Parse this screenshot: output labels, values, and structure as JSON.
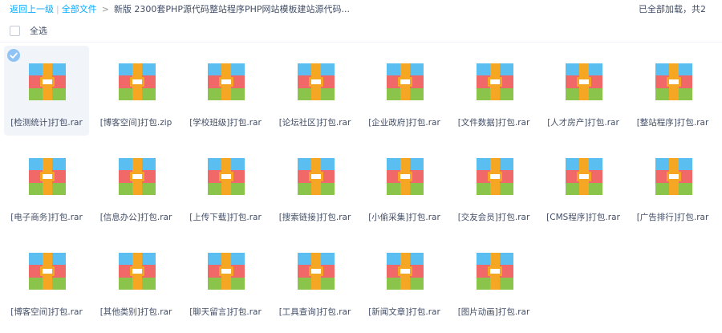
{
  "breadcrumb": {
    "back": "返回上一级",
    "all_files": "全部文件",
    "current": "新版 2300套PHP源代码整站程序PHP网站模板建站源代码..."
  },
  "status": "已全部加载，共2",
  "select_all_label": "全选",
  "colors": {
    "accent": "#09aaff",
    "selected_bg": "#f1f5fa",
    "check_badge": "#8fc3f5",
    "archive_top": "#5bbef0",
    "archive_middle": "#f06868",
    "archive_bottom": "#8ac44a",
    "archive_belt": "#f5a623"
  },
  "files": [
    {
      "name": "[检测统计]打包.rar",
      "selected": true,
      "icon": "archive-icon"
    },
    {
      "name": "[博客空间]打包.zip",
      "selected": false,
      "icon": "archive-icon"
    },
    {
      "name": "[学校班级]打包.rar",
      "selected": false,
      "icon": "archive-icon"
    },
    {
      "name": "[论坛社区]打包.rar",
      "selected": false,
      "icon": "archive-icon"
    },
    {
      "name": "[企业政府]打包.rar",
      "selected": false,
      "icon": "archive-icon"
    },
    {
      "name": "[文件数据]打包.rar",
      "selected": false,
      "icon": "archive-icon"
    },
    {
      "name": "[人才房产]打包.rar",
      "selected": false,
      "icon": "archive-icon"
    },
    {
      "name": "[整站程序]打包.rar",
      "selected": false,
      "icon": "archive-icon"
    },
    {
      "name": "[电子商务]打包.rar",
      "selected": false,
      "icon": "archive-icon"
    },
    {
      "name": "[信息办公]打包.rar",
      "selected": false,
      "icon": "archive-icon"
    },
    {
      "name": "[上传下载]打包.rar",
      "selected": false,
      "icon": "archive-icon"
    },
    {
      "name": "[搜索链接]打包.rar",
      "selected": false,
      "icon": "archive-icon"
    },
    {
      "name": "[小偷采集]打包.rar",
      "selected": false,
      "icon": "archive-icon"
    },
    {
      "name": "[交友会员]打包.rar",
      "selected": false,
      "icon": "archive-icon"
    },
    {
      "name": "[CMS程序]打包.rar",
      "selected": false,
      "icon": "archive-icon"
    },
    {
      "name": "[广告排行]打包.rar",
      "selected": false,
      "icon": "archive-icon"
    },
    {
      "name": "[博客空间]打包.rar",
      "selected": false,
      "icon": "archive-icon"
    },
    {
      "name": "[其他类别]打包.rar",
      "selected": false,
      "icon": "archive-icon"
    },
    {
      "name": "[聊天留言]打包.rar",
      "selected": false,
      "icon": "archive-icon"
    },
    {
      "name": "[工具查询]打包.rar",
      "selected": false,
      "icon": "archive-icon"
    },
    {
      "name": "[新闻文章]打包.rar",
      "selected": false,
      "icon": "archive-icon"
    },
    {
      "name": "[图片动画]打包.rar",
      "selected": false,
      "icon": "archive-icon"
    }
  ]
}
